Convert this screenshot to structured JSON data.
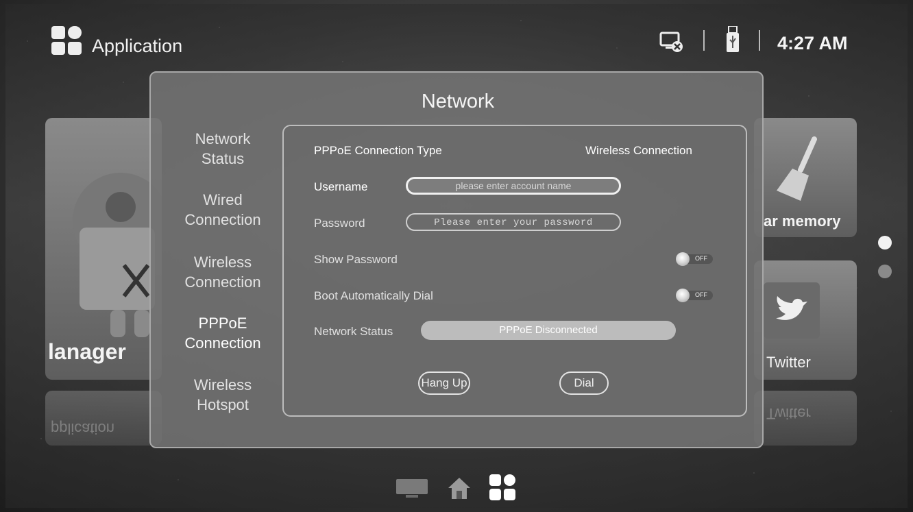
{
  "topbar": {
    "app_title": "Application",
    "clock": "4:27 AM",
    "icons": [
      "apps-icon",
      "screen-disconnected-icon",
      "usb-icon"
    ]
  },
  "background": {
    "tiles": {
      "left_label": "lanager",
      "right_top_label": "ar memory",
      "right_bottom_label": "Twitter",
      "left_reflection": "pplication",
      "right_reflection": "Twitter"
    },
    "page_dots": 2,
    "active_page_dot": 1
  },
  "network_dialog": {
    "title": "Network",
    "nav": [
      {
        "label": "Network\nStatus",
        "active": false
      },
      {
        "label": "Wired\nConnection",
        "active": false
      },
      {
        "label": "Wireless\nConnection",
        "active": false
      },
      {
        "label": "PPPoE\nConnection",
        "active": true
      },
      {
        "label": "Wireless\nHotspot",
        "active": false
      }
    ],
    "pppoe": {
      "connection_type_label": "PPPoE Connection Type",
      "connection_type_value": "Wireless Connection",
      "username_label": "Username",
      "username_placeholder": "please enter account name",
      "password_label": "Password",
      "password_placeholder": "Please enter your password",
      "show_password_label": "Show Password",
      "show_password_state": "OFF",
      "boot_dial_label": "Boot Automatically Dial",
      "boot_dial_state": "OFF",
      "network_status_label": "Network Status",
      "network_status_value": "PPPoE Disconnected",
      "hang_up_label": "Hang Up",
      "dial_label": "Dial"
    }
  },
  "dock": {
    "items": [
      "tv-icon",
      "home-icon",
      "apps-icon"
    ],
    "active": "apps-icon"
  },
  "colors": {
    "accent": "#ffffff",
    "panel": "#737373",
    "status_bar": "#bcbcbc"
  }
}
